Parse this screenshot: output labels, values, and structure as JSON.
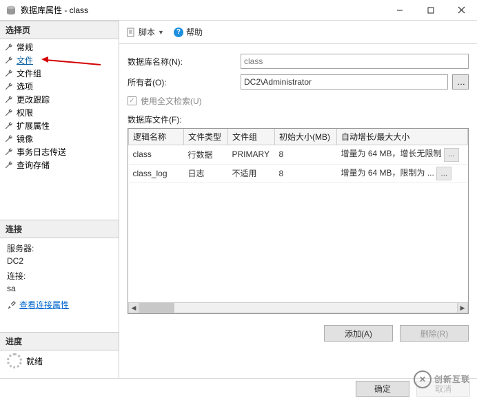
{
  "window": {
    "title": "数据库属性 - class"
  },
  "sidebar": {
    "select_header": "选择页",
    "items": [
      {
        "label": "常规"
      },
      {
        "label": "文件"
      },
      {
        "label": "文件组"
      },
      {
        "label": "选项"
      },
      {
        "label": "更改跟踪"
      },
      {
        "label": "权限"
      },
      {
        "label": "扩展属性"
      },
      {
        "label": "镜像"
      },
      {
        "label": "事务日志传送"
      },
      {
        "label": "查询存储"
      }
    ],
    "connection_header": "连接",
    "server_label": "服务器:",
    "server_value": "DC2",
    "conn_label": "连接:",
    "conn_value": "sa",
    "view_props": "查看连接属性",
    "progress_header": "进度",
    "progress_status": "就绪"
  },
  "toolbar": {
    "script": "脚本",
    "help": "帮助"
  },
  "form": {
    "dbname_label": "数据库名称(N):",
    "dbname_value": "class",
    "owner_label": "所有者(O):",
    "owner_value": "DC2\\Administrator",
    "fulltext_label": "使用全文检索(U)",
    "files_label": "数据库文件(F):"
  },
  "grid": {
    "cols": [
      "逻辑名称",
      "文件类型",
      "文件组",
      "初始大小(MB)",
      "自动增长/最大大小"
    ],
    "rows": [
      {
        "name": "class",
        "ftype": "行数据",
        "fgroup": "PRIMARY",
        "size": "8",
        "growth": "增量为 64 MB，增长无限制"
      },
      {
        "name": "class_log",
        "ftype": "日志",
        "fgroup": "不适用",
        "size": "8",
        "growth": "增量为 64 MB，限制为 ..."
      }
    ]
  },
  "buttons": {
    "add": "添加(A)",
    "remove": "删除(R)",
    "ok": "确定",
    "cancel": "取消"
  },
  "watermark": "创新互联"
}
